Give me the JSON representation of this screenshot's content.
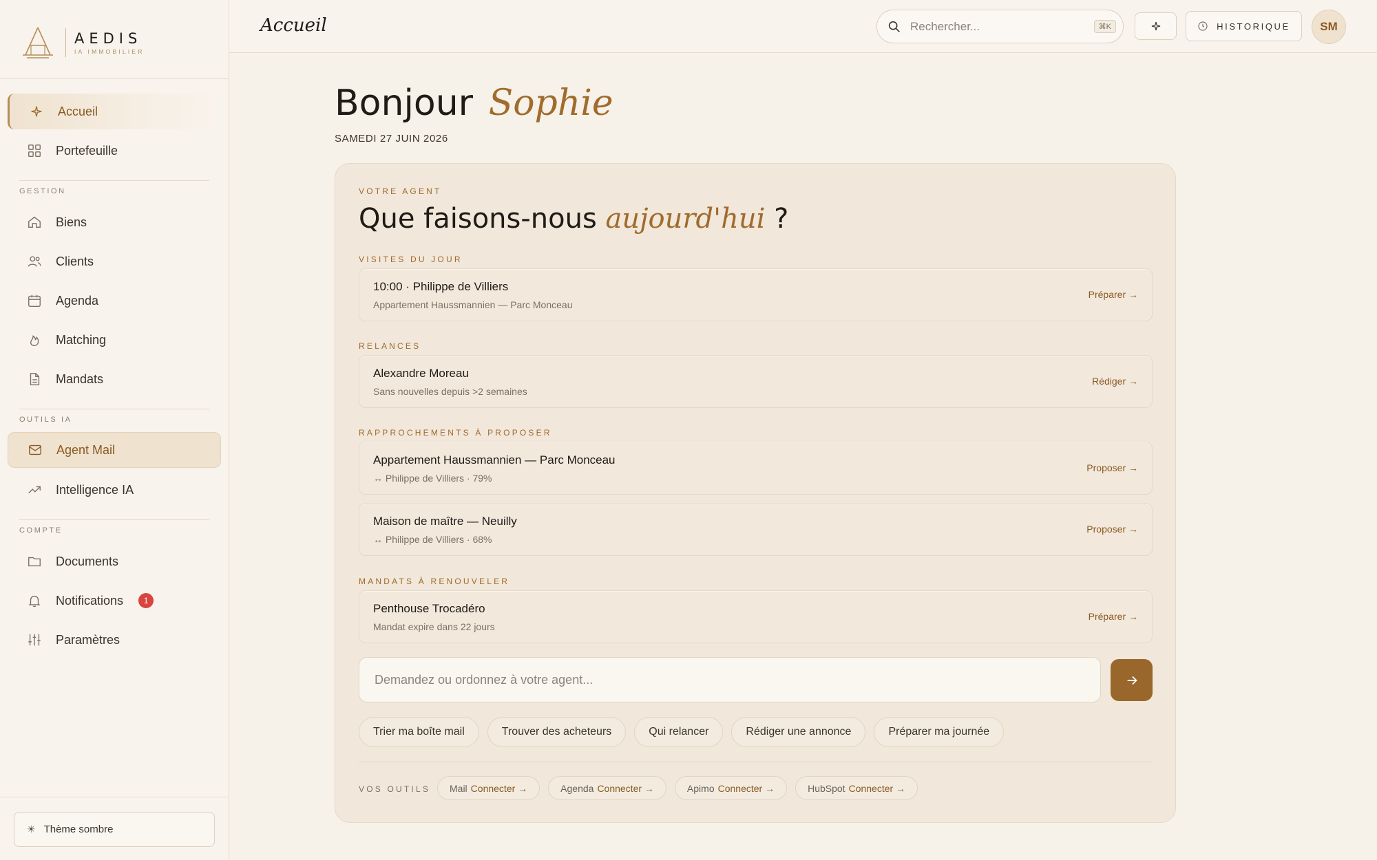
{
  "brand": {
    "name": "AEDIS",
    "tagline": "IA IMMOBILIER"
  },
  "sidebar": {
    "items_main": [
      {
        "label": "Accueil",
        "icon": "sparkle-icon",
        "state": "active"
      },
      {
        "label": "Portefeuille",
        "icon": "grid-icon"
      }
    ],
    "section_gestion": "GESTION",
    "items_gestion": [
      {
        "label": "Biens",
        "icon": "home-icon"
      },
      {
        "label": "Clients",
        "icon": "users-icon"
      },
      {
        "label": "Agenda",
        "icon": "calendar-icon"
      },
      {
        "label": "Matching",
        "icon": "flame-icon"
      },
      {
        "label": "Mandats",
        "icon": "document-icon"
      }
    ],
    "section_outils": "OUTILS IA",
    "items_outils": [
      {
        "label": "Agent Mail",
        "icon": "mail-icon",
        "state": "selected"
      },
      {
        "label": "Intelligence IA",
        "icon": "trend-icon"
      }
    ],
    "section_compte": "COMPTE",
    "items_compte": [
      {
        "label": "Documents",
        "icon": "folder-icon"
      },
      {
        "label": "Notifications",
        "icon": "bell-icon",
        "badge": "1"
      },
      {
        "label": "Paramètres",
        "icon": "sliders-icon"
      }
    ],
    "theme_toggle": "Thème sombre"
  },
  "topbar": {
    "title": "Accueil",
    "search_placeholder": "Rechercher...",
    "search_shortcut": "⌘K",
    "history_label": "HISTORIQUE",
    "avatar_initials": "SM"
  },
  "greeting": {
    "hello": "Bonjour",
    "name": "Sophie",
    "date": "SAMEDI 27 JUIN 2026"
  },
  "agent": {
    "eyebrow": "VOTRE AGENT",
    "title_start": "Que faisons-nous",
    "title_em": "aujourd'hui",
    "title_end": "?",
    "sections": {
      "visites": "VISITES DU JOUR",
      "relances": "RELANCES",
      "rapprochements": "RAPPROCHEMENTS À PROPOSER",
      "mandats": "MANDATS À RENOUVELER"
    },
    "rows": [
      {
        "title": "10:00 · Philippe de Villiers",
        "subtitle": "Appartement Haussmannien — Parc Monceau",
        "action": "Préparer →"
      },
      {
        "title": "Alexandre Moreau",
        "subtitle": "Sans nouvelles depuis >2 semaines",
        "action": "Rédiger →"
      },
      {
        "title": "Appartement Haussmannien — Parc Monceau",
        "subtitle": "↔ Philippe de Villiers · 79%",
        "action": "Proposer →"
      },
      {
        "title": "Maison de maître — Neuilly",
        "subtitle": "↔ Philippe de Villiers · 68%",
        "action": "Proposer →"
      },
      {
        "title": "Penthouse Trocadéro",
        "subtitle": "Mandat expire dans 22 jours",
        "action": "Préparer →"
      }
    ],
    "prompt_placeholder": "Demandez ou ordonnez à votre agent...",
    "chips": [
      "Trier ma boîte mail",
      "Trouver des acheteurs",
      "Qui relancer",
      "Rédiger une annonce",
      "Préparer ma journée"
    ],
    "tools_label": "VOS OUTILS",
    "tools": [
      {
        "name": "Mail",
        "action": "Connecter →"
      },
      {
        "name": "Agenda",
        "action": "Connecter →"
      },
      {
        "name": "Apimo",
        "action": "Connecter →"
      },
      {
        "name": "HubSpot",
        "action": "Connecter →"
      }
    ]
  },
  "colors": {
    "accent": "#a06b2c",
    "background": "#f6f1e9",
    "badge": "#d9443e",
    "send_button": "#99672c"
  }
}
